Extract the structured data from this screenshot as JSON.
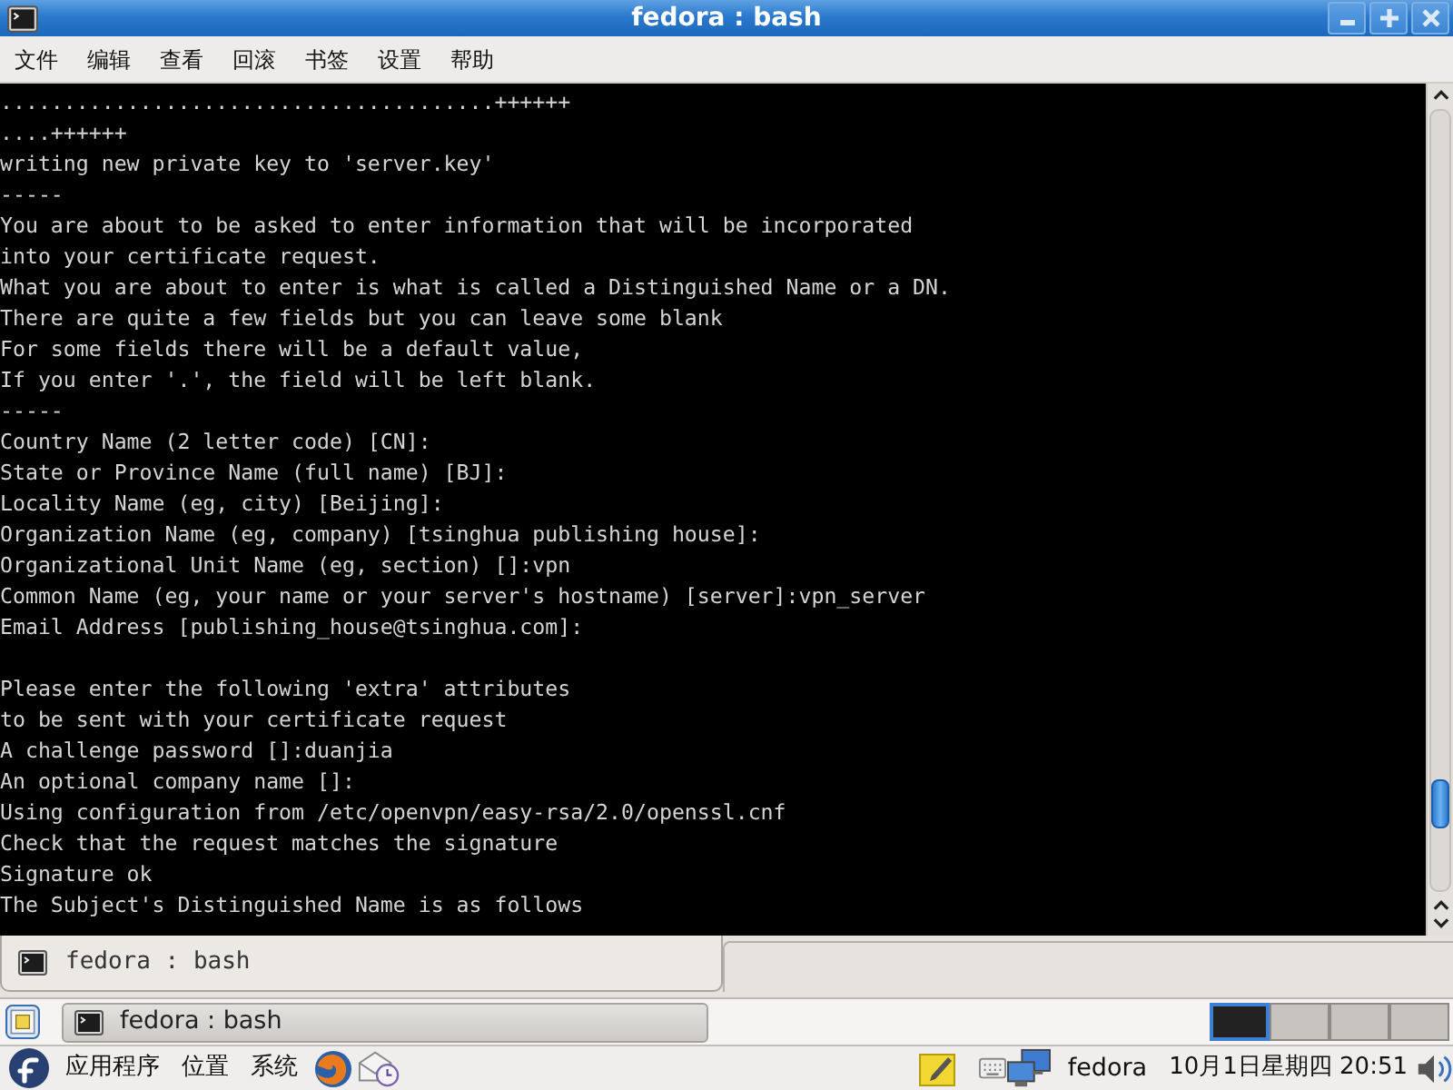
{
  "window": {
    "title": "fedora : bash",
    "menu": [
      "文件",
      "编辑",
      "查看",
      "回滚",
      "书签",
      "设置",
      "帮助"
    ]
  },
  "terminal": {
    "blocks": [
      [
        ".......................................++++++",
        "....++++++",
        "writing new private key to 'server.key'",
        "-----",
        "You are about to be asked to enter information that will be incorporated",
        "into your certificate request.",
        "What you are about to enter is what is called a Distinguished Name or a DN.",
        "There are quite a few fields but you can leave some blank",
        "For some fields there will be a default value,",
        "If you enter '.', the field will be left blank.",
        "-----",
        "Country Name (2 letter code) [CN]:",
        "State or Province Name (full name) [BJ]:",
        "Locality Name (eg, city) [Beijing]:",
        "Organization Name (eg, company) [tsinghua publishing house]:",
        "Organizational Unit Name (eg, section) []:vpn",
        "Common Name (eg, your name or your server's hostname) [server]:vpn_server",
        "Email Address [publishing_house@tsinghua.com]:"
      ],
      [
        "Please enter the following 'extra' attributes",
        "to be sent with your certificate request",
        "A challenge password []:duanjia",
        "An optional company name []:",
        "Using configuration from /etc/openvpn/easy-rsa/2.0/openssl.cnf",
        "Check that the request matches the signature",
        "Signature ok",
        "The Subject's Distinguished Name is as follows"
      ]
    ]
  },
  "tabs": [
    {
      "label": "fedora : bash",
      "selected": true
    }
  ],
  "taskbar": {
    "tasks": [
      {
        "label": "fedora : bash",
        "selected": true
      }
    ],
    "workspaces": [
      {
        "selected": true
      },
      {
        "selected": false
      },
      {
        "selected": false
      },
      {
        "selected": false
      }
    ]
  },
  "panel": {
    "menus": [
      "应用程序",
      "位置",
      "系统"
    ],
    "user": "fedora",
    "clock": "10月1日星期四 20:51"
  }
}
